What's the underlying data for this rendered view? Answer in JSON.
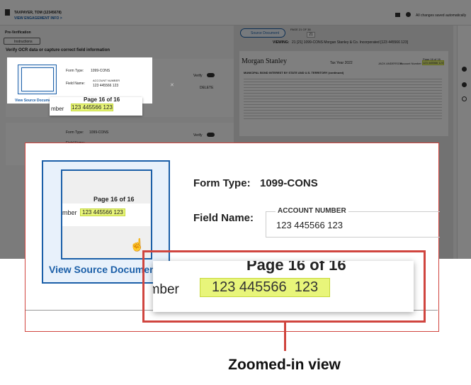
{
  "header": {
    "user": "TAXPAYER, TOM (12345678)",
    "engagement_link": "VIEW ENGAGEMENT INFO >",
    "save_status": "All changes saved automatically"
  },
  "left": {
    "section": "Pre-Verification",
    "instructions_button": "Instructions",
    "heading": "Verify OCR data or capture correct field information",
    "verify_label": "Verify",
    "delete_label": "DELETE"
  },
  "viewer": {
    "source_button": "Source Document",
    "page_label": "PAGE 21 OF 38",
    "page_value": "21",
    "viewing_label": "VIEWING:",
    "viewing_value": "21 [21] 1099-CONS Morgan Stanley & Co. Incorporated [123 445566 123]"
  },
  "doc": {
    "brand": "Morgan Stanley",
    "tax_year": "Tax Year 2022",
    "page_of": "Page 16 of 16",
    "account_label": "Account Number",
    "account_value": "123 445566 123",
    "name": "JACK ANDERSON",
    "section_title": "MUNICIPAL BOND INTEREST BY STATE AND U.S. TERRITORY (continued)"
  },
  "card1": {
    "form_type_label": "Form Type:",
    "form_type": "1099-CONS",
    "field_name_label": "Field Name:",
    "field_label": "ACCOUNT NUMBER",
    "field_value": "123 445566 123",
    "view_source": "View Source Document"
  },
  "card2": {
    "form_type_label": "Form Type:",
    "form_type": "1099-CONS",
    "field_name_label": "Field Name:"
  },
  "thumb": {
    "page_text": "Page 16 of 16",
    "prefix": "mber",
    "value": "123 445566 123"
  },
  "zoom": {
    "form_type_label": "Form Type:",
    "form_type": "1099-CONS",
    "field_name_label": "Field Name:",
    "field_label": "ACCOUNT NUMBER",
    "field_value": "123 445566 123",
    "view_source": "View Source Documen",
    "thumb_page": "Page 16 of 16",
    "thumb_prefix": "mber",
    "thumb_value": "123 445566 123"
  },
  "lens": {
    "page_text": "Page 16 of 16",
    "prefix": "umber",
    "value": "123 445566  123"
  },
  "caption": "Zoomed-in view"
}
